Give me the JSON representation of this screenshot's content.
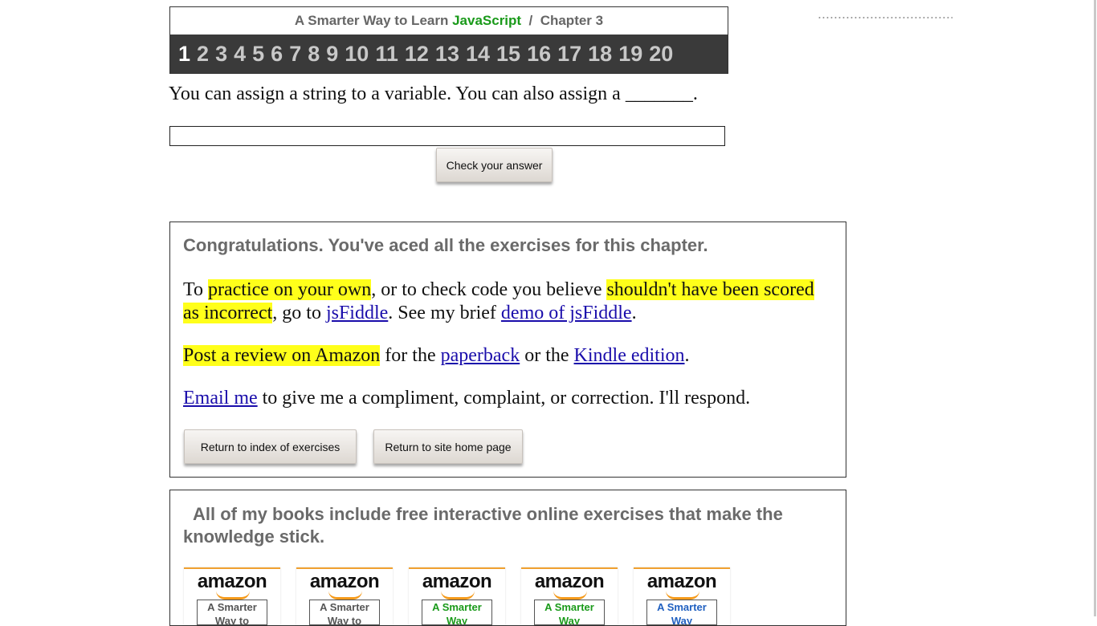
{
  "header": {
    "title_prefix": "A Smarter Way to Learn ",
    "title_brand": "JavaScript",
    "title_suffix": "  /  Chapter 3",
    "brand_color": "#1a9a1a",
    "chapters": [
      "1",
      "2",
      "3",
      "4",
      "5",
      "6",
      "7",
      "8",
      "9",
      "10",
      "11",
      "12",
      "13",
      "14",
      "15",
      "16",
      "17",
      "18",
      "19",
      "20"
    ],
    "current_chapter": "1"
  },
  "question": {
    "text": "You can assign a string to a variable. You can also assign a _______.",
    "answer_value": "",
    "check_button": "Check your answer"
  },
  "congrats": {
    "heading": "Congratulations. You've aced all the exercises for this chapter.",
    "p1": {
      "t1": "To ",
      "h1": "practice on your own",
      "t2": ", or to check code you believe ",
      "h2": "shouldn't have been scored as incorrect",
      "t3": ", go to ",
      "link1": "jsFiddle",
      "t4": ". See my brief ",
      "link2": "demo of jsFiddle",
      "t5": "."
    },
    "p2": {
      "h1": "Post a review on Amazon",
      "t1": " for the ",
      "link1": "paperback",
      "t2": " or the ",
      "link2": "Kindle edition",
      "t3": "."
    },
    "p3": {
      "link1": "Email me",
      "t1": " to give me a compliment, complaint, or correction. I'll respond."
    },
    "button_index": "Return to index of exercises",
    "button_home": "Return to site home page"
  },
  "books": {
    "heading": "All of my books include free interactive online exercises that make the knowledge stick.",
    "items": [
      {
        "logo": "amazon",
        "cover_text": "A Smarter Way to",
        "cover_color": "#555555"
      },
      {
        "logo": "amazon",
        "cover_text": "A Smarter Way to",
        "cover_color": "#555555"
      },
      {
        "logo": "amazon",
        "cover_text": "A Smarter Way",
        "cover_color": "#1a9a1a"
      },
      {
        "logo": "amazon",
        "cover_text": "A Smarter Way",
        "cover_color": "#1a9a1a"
      },
      {
        "logo": "amazon",
        "cover_text": "A Smarter Way",
        "cover_color": "#2060c0"
      }
    ]
  },
  "colors": {
    "highlight": "#ffff1a",
    "nav_background": "#3a3a3a",
    "link": "#1a0dab"
  }
}
